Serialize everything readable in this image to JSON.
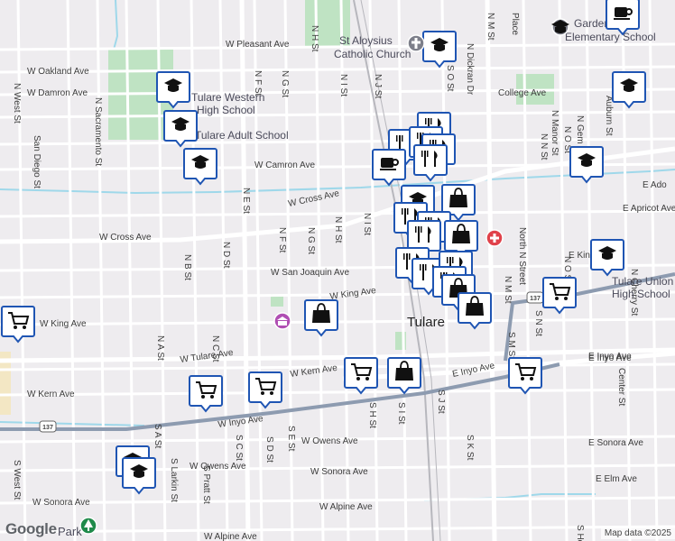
{
  "map": {
    "city_label": "Tulare",
    "logo": "Google",
    "attribution": "Map data ©2025",
    "streets": [
      "N H St",
      "W Pleasant Ave",
      "N F St",
      "N G St",
      "N I St",
      "N J St",
      "N Dickran Dr",
      "N M St",
      "Place",
      "N West St",
      "N Sacramento St",
      "W Oakland Ave",
      "W Damron Ave",
      "San Diego St",
      "W Camron Ave",
      "W Cross Ave",
      "W Cross Ave",
      "N D St",
      "N B St",
      "N E St",
      "N F St",
      "N G St",
      "N H St",
      "N I St",
      "W San Joaquin Ave",
      "W King Ave",
      "W King Ave",
      "N A St",
      "N C St",
      "W Tulare Ave",
      "W Kern Ave",
      "W Kern Ave",
      "W Inyo Ave",
      "E Inyo Ave",
      "E Inyo Ave",
      "W Owens Ave",
      "W Owens Ave",
      "W Sonora Ave",
      "W Sonora Ave",
      "W Alpine Ave",
      "W Alpine Ave",
      "S West St",
      "S A St",
      "S Larkin St",
      "S Pratt St",
      "S C St",
      "S D St",
      "S E St",
      "S H St",
      "S I St",
      "S J St",
      "S K St",
      "College Ave",
      "N N St",
      "N O St",
      "N Manor St",
      "N Gem St",
      "Auburn St",
      "E Apricot Ave",
      "E Ado",
      "North N Street",
      "N M St",
      "N O St",
      "S N St",
      "S M St",
      "E King",
      "E Inyo Ave",
      "Center St",
      "E Sonora Ave",
      "E Elm Ave",
      "N Cherry St",
      "S How",
      "S O St",
      "Place Dr"
    ],
    "pois": [
      {
        "name": "St Aloysius Catholic Church"
      },
      {
        "name": "Garden Elementary School"
      },
      {
        "name": "Tulare Western High School"
      },
      {
        "name": "Tulare Adult School"
      },
      {
        "name": "Tulare Union High School"
      },
      {
        "name": "Park"
      }
    ],
    "marker_categories": {
      "school": "graduation-cap-icon",
      "restaurant": "fork-knife-icon",
      "cafe": "coffee-cup-icon",
      "store": "shopping-bag-icon",
      "grocery": "shopping-cart-icon",
      "museum": "museum-icon",
      "hospital": "hospital-icon",
      "church": "church-icon",
      "park": "tree-icon"
    },
    "highway_shield": "137",
    "colors": {
      "background": "#eeecef",
      "road": "#ffffff",
      "highway": "#8d9bb0",
      "park": "#bfe3c3",
      "water": "#9fd8ea",
      "marker_fill": "#ffffff",
      "marker_border": "#1f55b3",
      "marker_icon": "#111111",
      "hospital": "#e0414a"
    }
  }
}
